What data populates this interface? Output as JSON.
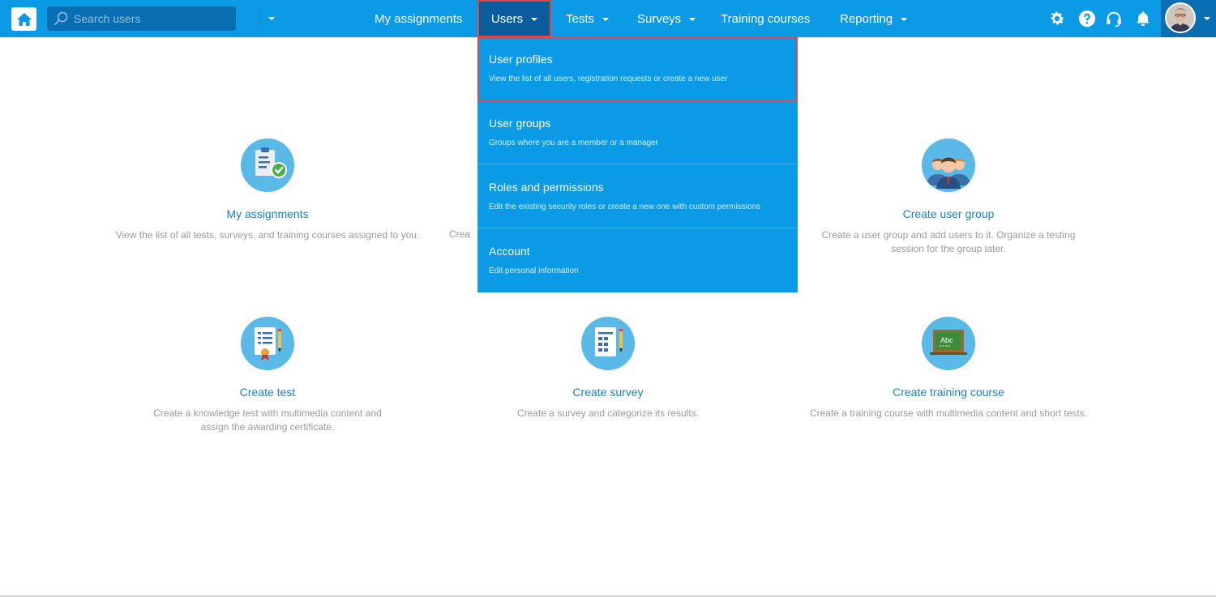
{
  "search": {
    "placeholder": "Search users"
  },
  "nav": [
    {
      "label": "My assignments"
    },
    {
      "label": "Users"
    },
    {
      "label": "Tests"
    },
    {
      "label": "Surveys"
    },
    {
      "label": "Training courses"
    },
    {
      "label": "Reporting"
    }
  ],
  "top_icons": [
    "gear-icon",
    "help-icon",
    "headset-icon",
    "bell-icon"
  ],
  "users_menu": [
    {
      "title": "User profiles",
      "desc": "View the list of all users, registration requests or create a new user"
    },
    {
      "title": "User groups",
      "desc": "Groups where you are a member or a manager"
    },
    {
      "title": "Roles and permissions",
      "desc": "Edit the existing security roles or create a new one with custom permissions"
    },
    {
      "title": "Account",
      "desc": "Edit personal information"
    }
  ],
  "cards": [
    {
      "title": "My assignments",
      "desc": "View the list of all tests, surveys, and training courses assigned to you.",
      "icon": "clipboard-check-icon"
    },
    {
      "title": "",
      "desc": "Crea",
      "icon": ""
    },
    {
      "title": "Create user group",
      "desc": "Create a user group and add users to it. Organize a testing session for the group later.",
      "icon": "user-group-icon"
    },
    {
      "title": "Create test",
      "desc": "Create a knowledge test with multimedia content and assign the awarding certificate.",
      "icon": "test-certificate-icon"
    },
    {
      "title": "Create survey",
      "desc": "Create a survey and categorize its results.",
      "icon": "survey-form-icon"
    },
    {
      "title": "Create training course",
      "desc": "Create a training course with multimedia content and short tests.",
      "icon": "chalkboard-icon"
    }
  ],
  "chalkboard_text": "Abc",
  "colors": {
    "topbar": "#0b9be6",
    "highlight": "#e04848",
    "link": "#1b7fc4",
    "active_nav": "#0a5d9c"
  }
}
